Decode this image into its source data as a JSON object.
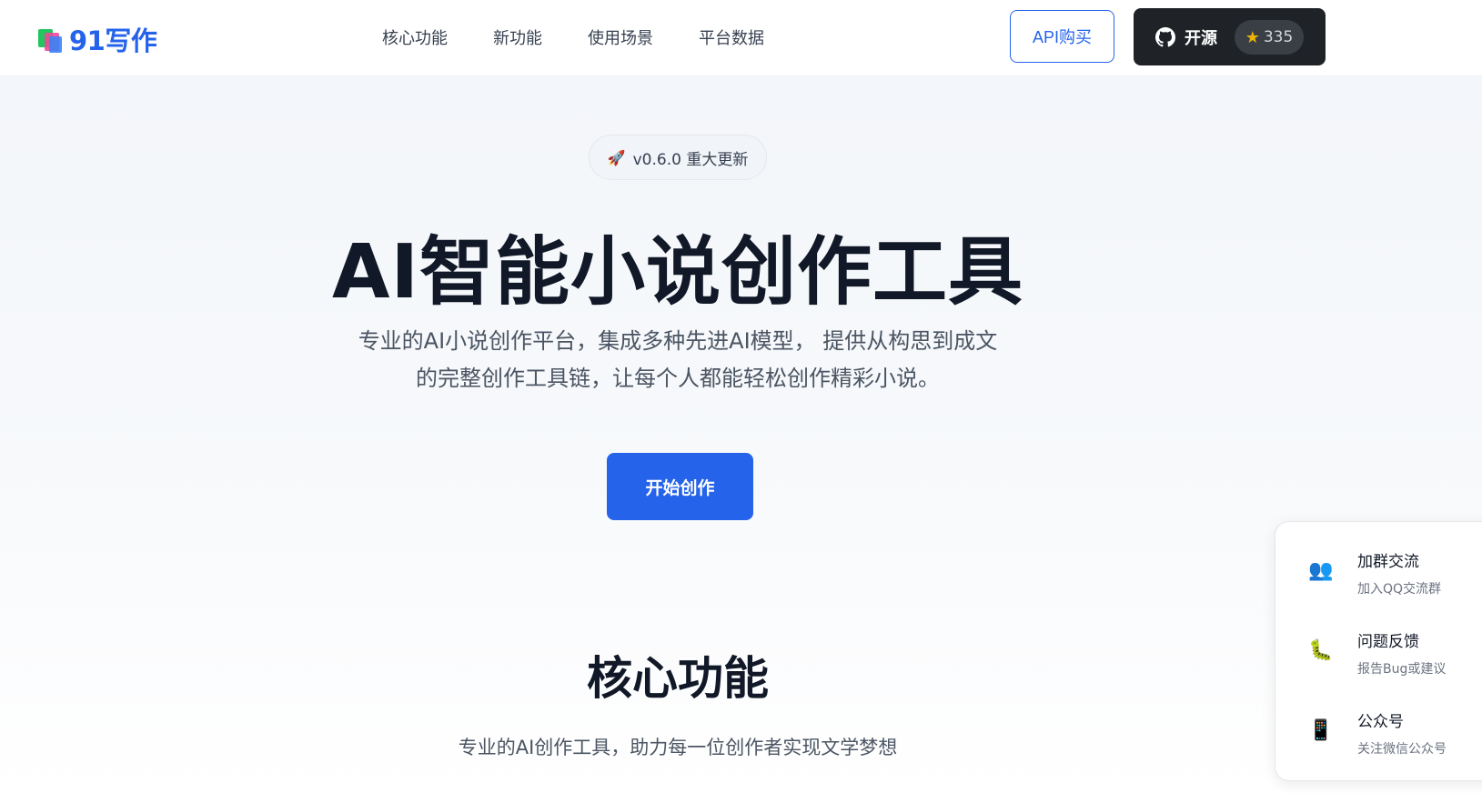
{
  "header": {
    "logo_text": "91写作",
    "nav": [
      "核心功能",
      "新功能",
      "使用场景",
      "平台数据"
    ],
    "api_button": "API购买",
    "github_label": "开源",
    "star_count": "335"
  },
  "hero": {
    "badge_icon": "🚀",
    "badge_text": "v0.6.0 重大更新",
    "title": "AI智能小说创作工具",
    "desc_line1": "专业的AI小说创作平台，集成多种先进AI模型， 提供从构思到成文",
    "desc_line2": "的完整创作工具链，让每个人都能轻松创作精彩小说。",
    "cta": "开始创作"
  },
  "section": {
    "title": "核心功能",
    "subtitle": "专业的AI创作工具，助力每一位创作者实现文学梦想"
  },
  "float_panel": {
    "items": [
      {
        "icon": "👥",
        "title": "加群交流",
        "subtitle": "加入QQ交流群"
      },
      {
        "icon": "🐛",
        "title": "问题反馈",
        "subtitle": "报告Bug或建议"
      },
      {
        "icon": "📱",
        "title": "公众号",
        "subtitle": "关注微信公众号"
      }
    ]
  },
  "colors": {
    "brand": "#2563eb",
    "dark": "#1f2328",
    "star": "#eab308"
  }
}
